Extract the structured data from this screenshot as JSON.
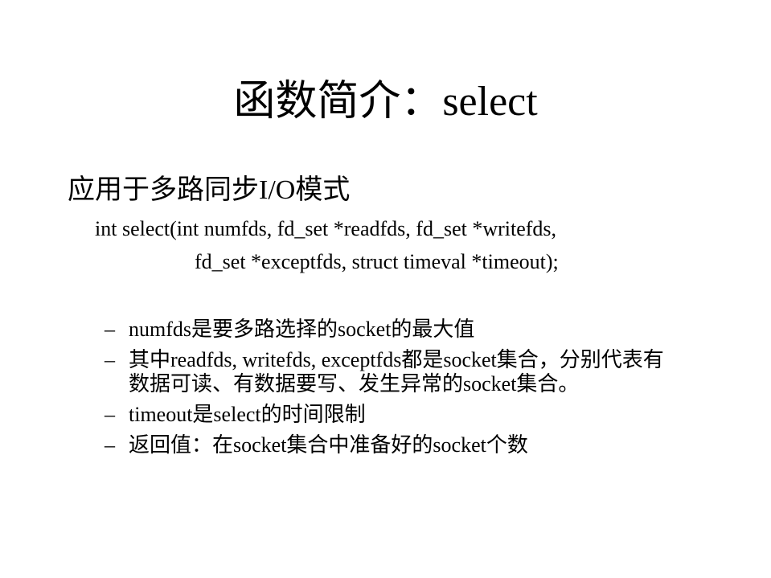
{
  "slide": {
    "title": "函数简介：select",
    "bullet": "应用于多路同步I/O模式",
    "code": {
      "line1": "int select(int numfds, fd_set *readfds, fd_set *writefds,",
      "line2": "fd_set *exceptfds, struct timeval *timeout);"
    },
    "dash": "–",
    "items": [
      "numfds是要多路选择的socket的最大值",
      "其中readfds, writefds, exceptfds都是socket集合，分别代表有数据可读、有数据要写、发生异常的socket集合。",
      "timeout是select的时间限制",
      "返回值：在socket集合中准备好的socket个数"
    ]
  }
}
